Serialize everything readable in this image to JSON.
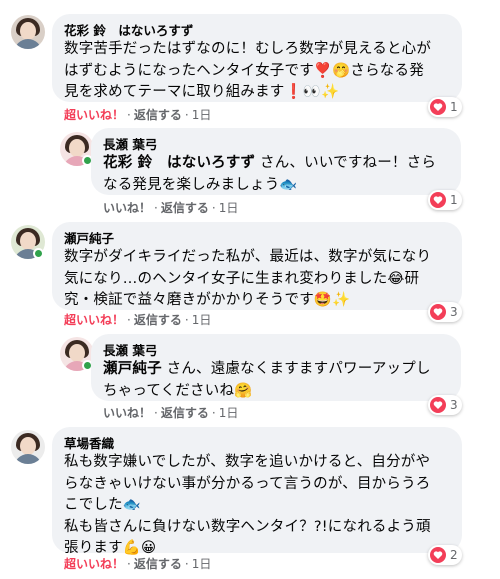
{
  "colors": {
    "bubble": "#f0f2f5",
    "liked": "#f33e58",
    "meta": "#65676b",
    "online": "#31a24c"
  },
  "comments": [
    {
      "author": "花彩 鈴　はないろすず",
      "lines": [
        "数字苦手だったはずなのに！むしろ数字が見えると心が",
        "はずむようになったヘンタイ女子です❣️🤭さらなる発",
        "見を求めてテーマに取り組みます❗👀✨"
      ],
      "like": "超いいね！",
      "reply": "返信する",
      "time": "1日",
      "reaction_icon": "heart-icon",
      "reaction_count": "1"
    },
    {
      "author": "長瀬 葉弓",
      "mention": "花彩 鈴　はないろすず",
      "lines": [
        " さん、いいですねー！さら",
        "なる発見を楽しみましょう🐟"
      ],
      "like": "いいね！",
      "reply": "返信する",
      "time": "1日",
      "reaction_icon": "heart-icon",
      "reaction_count": "1"
    },
    {
      "author": "瀬戸純子",
      "lines": [
        "数字がダイキライだった私が、最近は、数字が気になり",
        "気になり…のヘンタイ女子に生まれ変わりました😂研",
        "究・検証で益々磨きがかかりそうです🤩✨"
      ],
      "like": "超いいね！",
      "reply": "返信する",
      "time": "1日",
      "reaction_icon": "heart-icon",
      "reaction_count": "3"
    },
    {
      "author": "長瀬 葉弓",
      "mention": "瀬戸純子",
      "lines": [
        " さん、遠慮なくますますパワーアップし",
        "ちゃってくださいね🤗"
      ],
      "like": "いいね！",
      "reply": "返信する",
      "time": "1日",
      "reaction_icon": "heart-icon",
      "reaction_count": "3"
    },
    {
      "author": "草場香織",
      "lines": [
        "私も数字嫌いでしたが、数字を追いかけると、自分がや",
        "らなきゃいけない事が分かるって言うのが、目からうろ",
        "こでした🐟",
        "私も皆さんに負けない数字ヘンタイ？?!になれるよう頑",
        "張ります💪😀"
      ],
      "like": "超いいね！",
      "reply": "返信する",
      "time": "1日",
      "reaction_icon": "heart-icon",
      "reaction_count": "2"
    }
  ]
}
